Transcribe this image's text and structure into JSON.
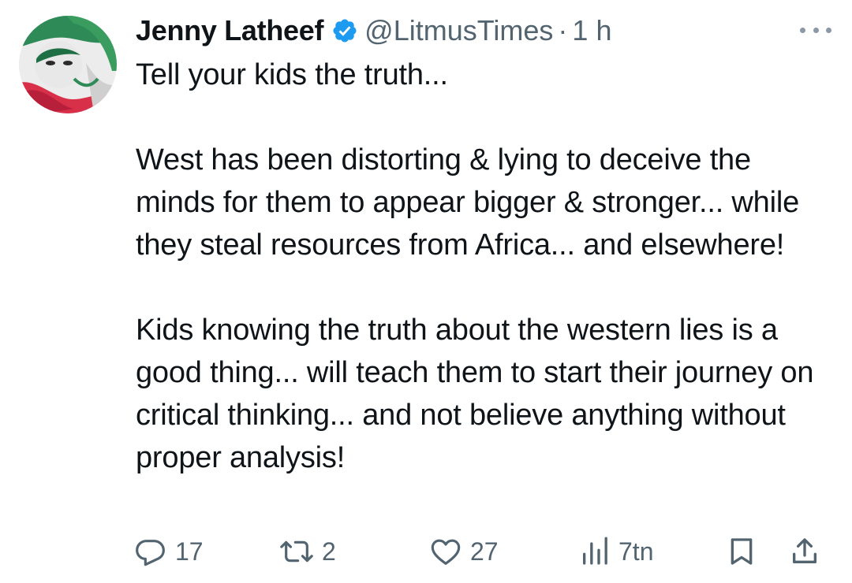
{
  "tweet": {
    "author_name": "Jenny Latheef",
    "handle": "@LitmusTimes",
    "separator": "·",
    "time": "1 h",
    "paragraphs": [
      "Tell your kids the truth...",
      "West has been distorting & lying to deceive the minds for them to appear bigger & stronger... while they steal resources from Africa... and elsewhere!",
      "Kids knowing the truth about the western lies is a good thing... will teach them to start their journey on critical thinking... and not believe anything without proper analysis!"
    ],
    "replies": "17",
    "retweets": "2",
    "likes": "27",
    "views": "7tn"
  },
  "icons": {
    "verified": "verified-badge-icon",
    "more": "more-options-icon",
    "reply": "reply-icon",
    "retweet": "retweet-icon",
    "like": "heart-icon",
    "views": "views-icon",
    "bookmark": "bookmark-icon",
    "share": "share-icon"
  },
  "colors": {
    "text": "#0f1419",
    "secondary": "#536471",
    "verified_blue": "#1d9bf0"
  }
}
